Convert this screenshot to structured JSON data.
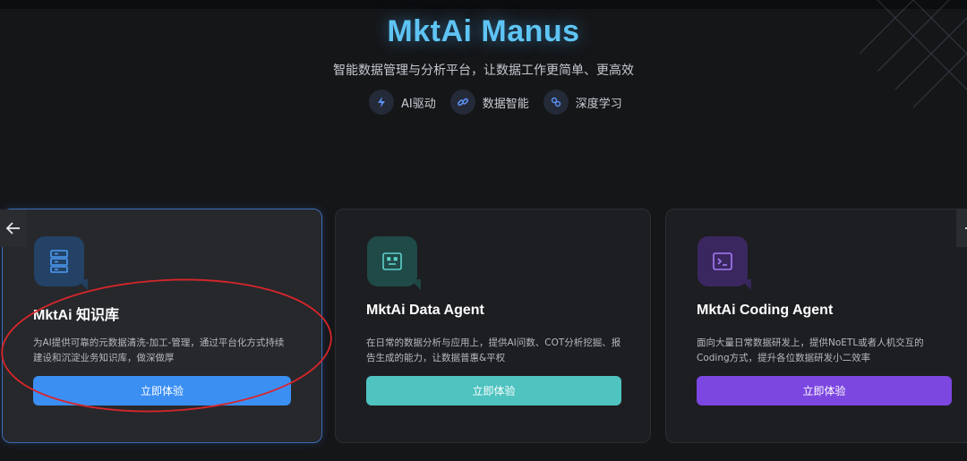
{
  "header": {
    "title": "MktAi Manus",
    "subtitle": "智能数据管理与分析平台，让数据工作更简单、更高效",
    "features": [
      {
        "label": "AI驱动",
        "icon": "lightning-icon"
      },
      {
        "label": "数据智能",
        "icon": "link-icon"
      },
      {
        "label": "深度学习",
        "icon": "brain-icon"
      }
    ]
  },
  "cards": [
    {
      "title": "MktAi 知识库",
      "description": "为AI提供可靠的元数据清洗-加工-管理，通过平台化方式持续建设和沉淀业务知识库，做深做厚",
      "button": "立即体验",
      "icon": "database-icon",
      "accent": "#3b8ff3"
    },
    {
      "title": "MktAi Data Agent",
      "description": "在日常的数据分析与应用上，提供AI问数、COT分析挖掘、报告生成的能力，让数据普惠&平权",
      "button": "立即体验",
      "icon": "robot-icon",
      "accent": "#4ec3c0"
    },
    {
      "title": "MktAi Coding Agent",
      "description": "面向大量日常数据研发上，提供NoETL或者人机交互的Coding方式，提升各位数据研发小二效率",
      "button": "立即体验",
      "icon": "terminal-icon",
      "accent": "#7c46e0"
    }
  ],
  "carousel": {
    "prev_icon": "arrow-left-icon",
    "next_icon": "arrow-right-icon"
  },
  "annotation": {
    "color": "#d8262a",
    "shape": "ellipse"
  }
}
